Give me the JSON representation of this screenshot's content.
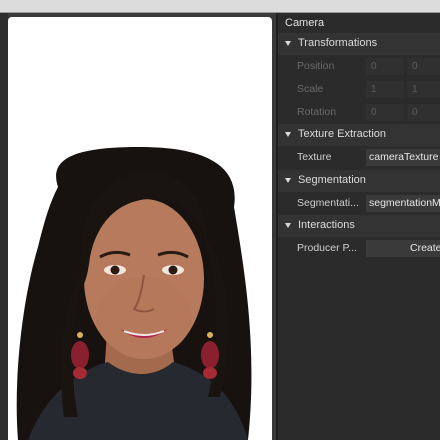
{
  "inspector": {
    "title": "Camera",
    "transformations": {
      "label": "Transformations",
      "position": {
        "label": "Position",
        "x": "0",
        "y": "0"
      },
      "scale": {
        "label": "Scale",
        "x": "1",
        "y": "1"
      },
      "rotation": {
        "label": "Rotation",
        "x": "0",
        "y": "0"
      }
    },
    "texture_extraction": {
      "label": "Texture Extraction",
      "texture": {
        "label": "Texture",
        "value": "cameraTexture"
      }
    },
    "segmentation": {
      "label": "Segmentation",
      "field": {
        "label": "Segmentati...",
        "value": "segmentationM"
      }
    },
    "interactions": {
      "label": "Interactions",
      "producer": {
        "label": "Producer P...",
        "button": "Create"
      }
    }
  }
}
